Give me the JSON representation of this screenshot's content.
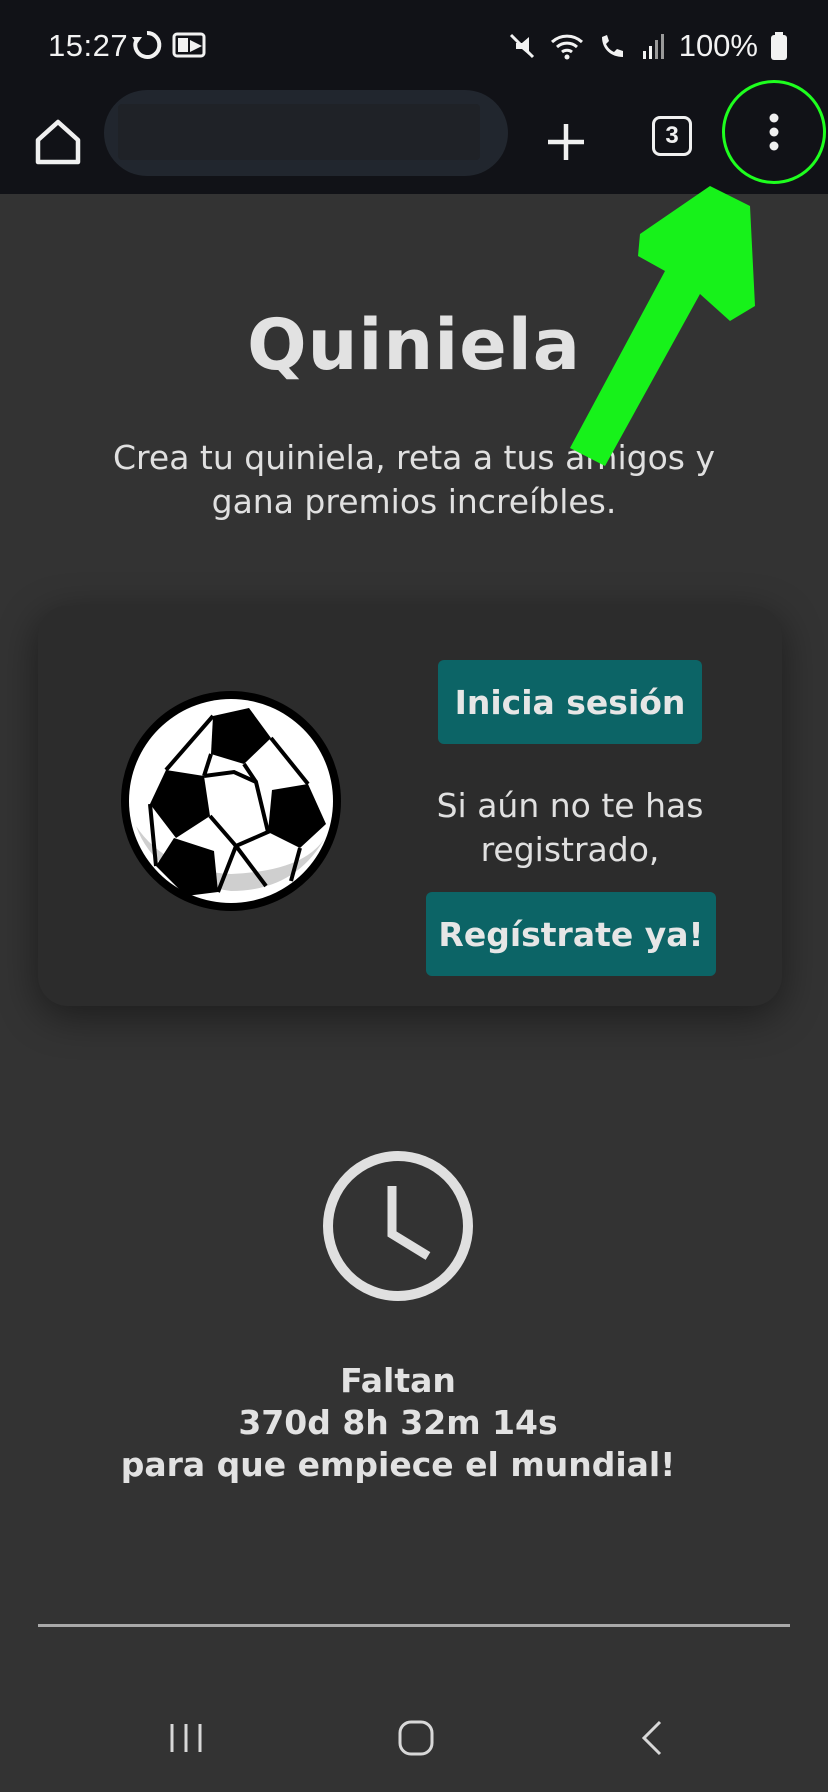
{
  "status_bar": {
    "time": "15:27",
    "battery": "100%",
    "icons": [
      "sync-icon",
      "voicemail-icon",
      "mute-icon",
      "wifi-icon",
      "wifi-calling-icon",
      "signal-icon",
      "battery-icon"
    ]
  },
  "browser": {
    "tab_count": "3",
    "icons": [
      "home-icon",
      "plus-icon",
      "more-vert-icon"
    ],
    "highlight_color": "#1eff1e"
  },
  "page": {
    "title": "Quiniela",
    "subtitle": "Crea tu quiniela, reta a tus amigos y gana premios increíbles.",
    "card": {
      "login_label": "Inicia sesión",
      "register_hint": "Si aún no te has registrado,",
      "register_label": "Regístrate ya!",
      "button_color": "#0c6466"
    },
    "countdown": {
      "line1": "Faltan",
      "line2": "370d 8h 32m 14s",
      "line3": "para que empiece el mundial!"
    }
  },
  "nav_bar": {
    "icons": [
      "recent-apps-icon",
      "home-circle-icon",
      "back-icon"
    ]
  }
}
